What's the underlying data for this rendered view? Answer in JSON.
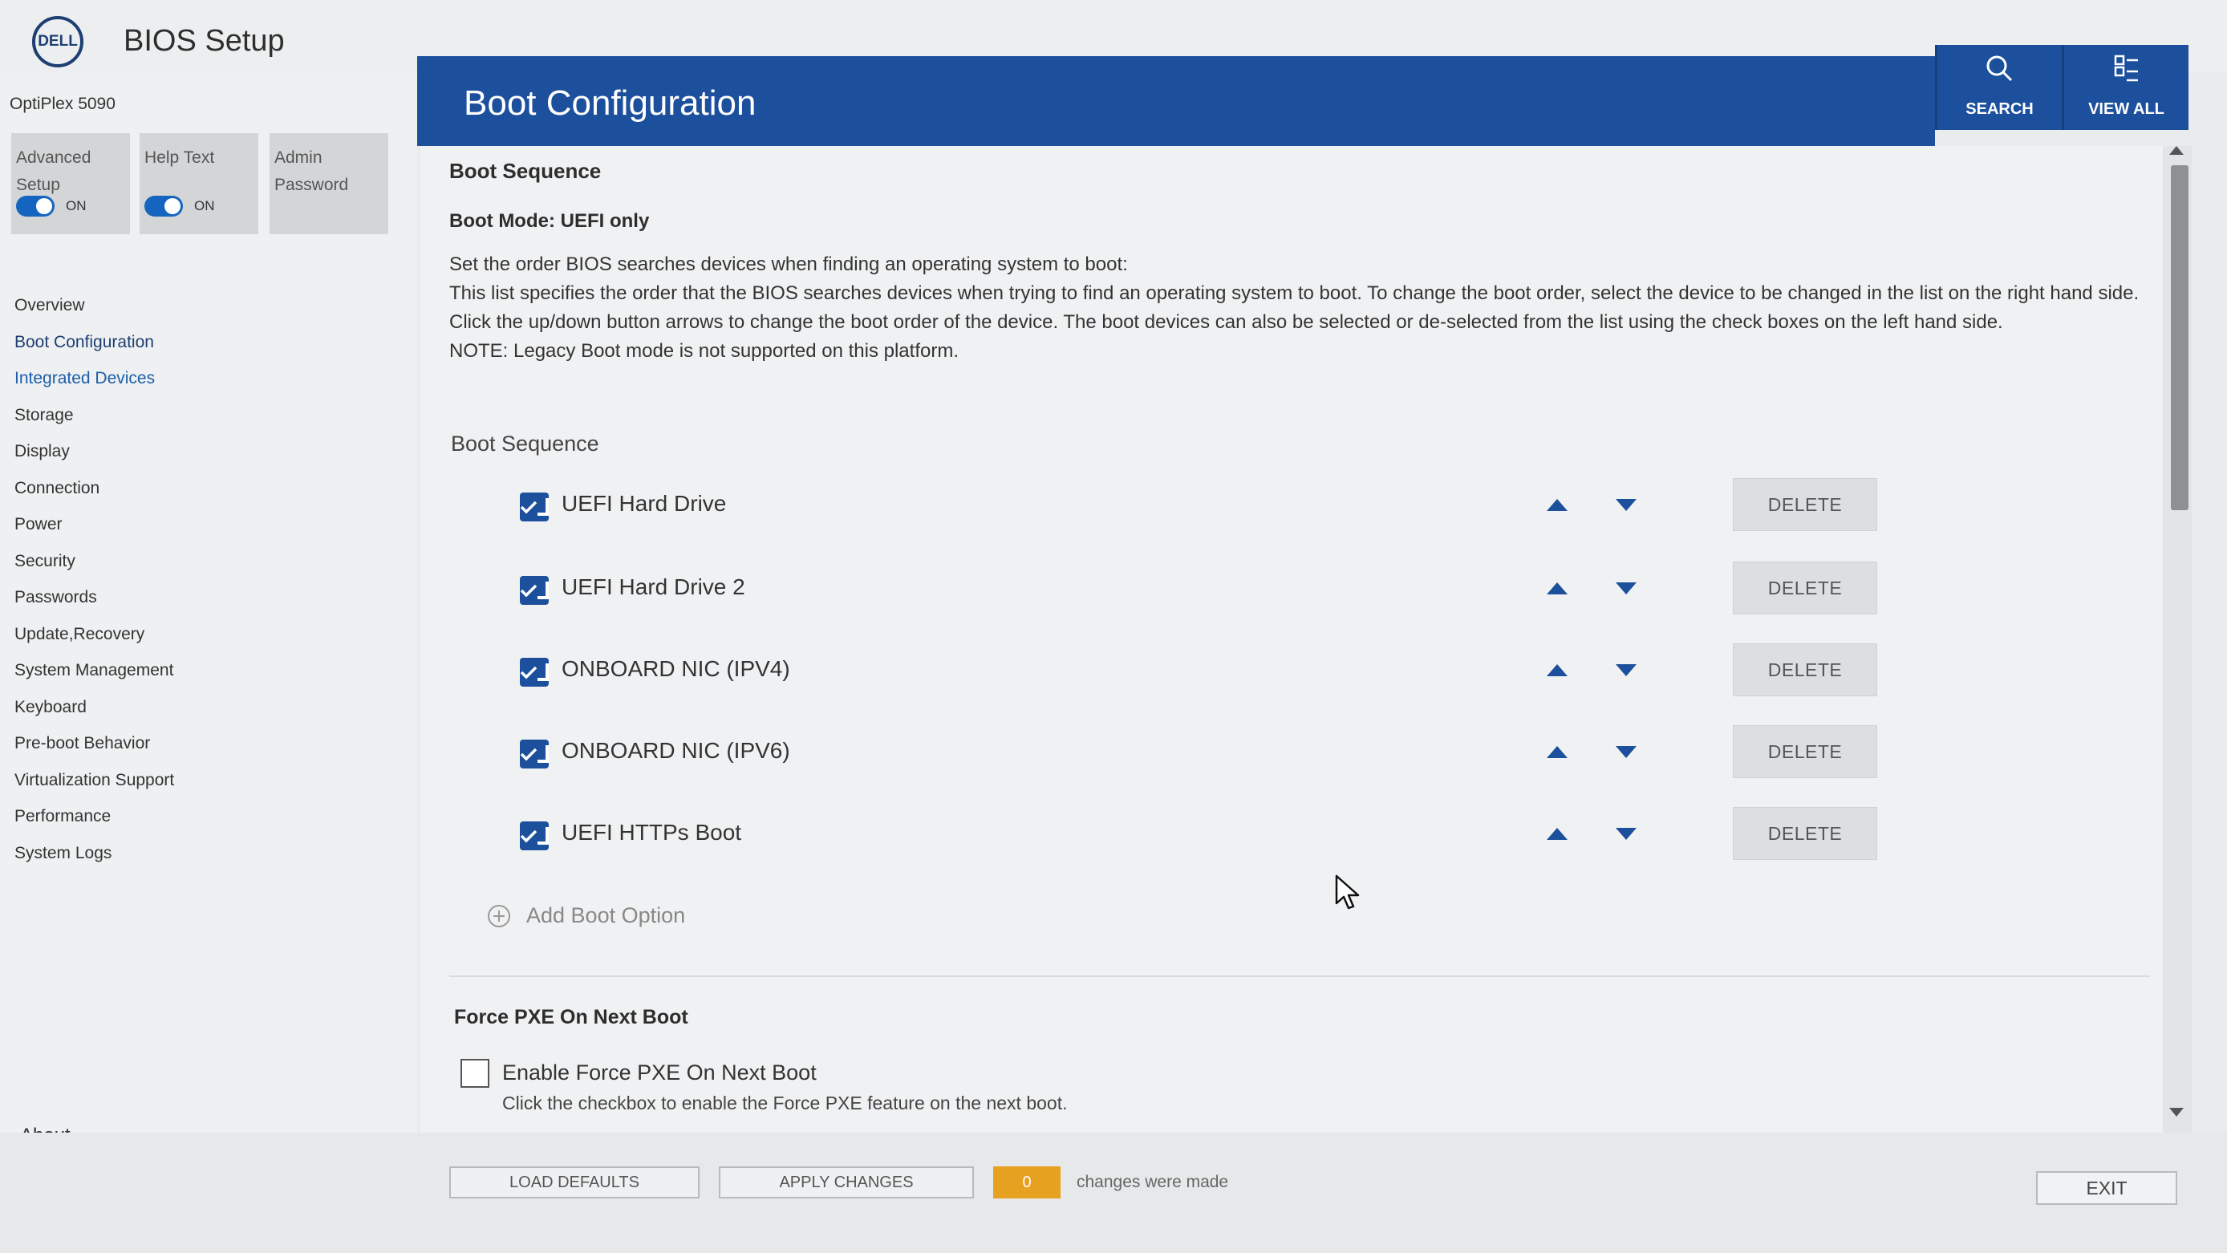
{
  "app": {
    "logo_text": "DELL",
    "title": "BIOS Setup"
  },
  "sidebar": {
    "model": "OptiPlex 5090",
    "tiles": [
      {
        "label": "Advanced Setup",
        "toggle": "ON"
      },
      {
        "label": "Help Text",
        "toggle": "ON"
      },
      {
        "label": "Admin Password"
      }
    ],
    "nav": [
      "Overview",
      "Boot Configuration",
      "Integrated Devices",
      "Storage",
      "Display",
      "Connection",
      "Power",
      "Security",
      "Passwords",
      "Update,Recovery",
      "System Management",
      "Keyboard",
      "Pre-boot Behavior",
      "Virtualization Support",
      "Performance",
      "System Logs"
    ],
    "about": "About"
  },
  "header": {
    "title": "Boot Configuration",
    "search_label": "SEARCH",
    "view_all_label": "VIEW ALL"
  },
  "main": {
    "section_title": "Boot Sequence",
    "boot_mode": "Boot Mode: UEFI only",
    "desc_line1": "Set the order BIOS searches devices when finding an operating system to boot:",
    "desc_line2": "This list specifies the order that the BIOS searches devices when trying to find an operating system to boot.  To change the boot order, select the device to be changed in the list on the right hand side.  Click the up/down button arrows to change the boot order of the device.  The boot devices can also be selected or de-selected from the list using the check boxes on the left hand side.",
    "desc_note": "NOTE: Legacy Boot mode is not supported on this platform.",
    "sequence_label": "Boot Sequence",
    "boot_options": [
      {
        "name": "UEFI Hard Drive",
        "checked": true,
        "delete_label": "DELETE"
      },
      {
        "name": "UEFI Hard Drive 2",
        "checked": true,
        "delete_label": "DELETE"
      },
      {
        "name": "ONBOARD NIC (IPV4)",
        "checked": true,
        "delete_label": "DELETE"
      },
      {
        "name": "ONBOARD NIC (IPV6)",
        "checked": true,
        "delete_label": "DELETE"
      },
      {
        "name": "UEFI HTTPs Boot",
        "checked": true,
        "delete_label": "DELETE"
      }
    ],
    "add_boot_label": "Add Boot Option",
    "pxe_title": "Force PXE On Next Boot",
    "pxe_checkbox_label": "Enable Force PXE On Next Boot",
    "pxe_checked": false,
    "pxe_help": "Click the checkbox to enable the Force PXE feature on the next boot."
  },
  "footer": {
    "load_defaults": "LOAD DEFAULTS",
    "apply_changes": "APPLY CHANGES",
    "change_count": "0",
    "changes_text": "changes were made",
    "exit": "EXIT"
  },
  "colors": {
    "accent": "#1c4f9c",
    "badge": "#e7a120"
  }
}
